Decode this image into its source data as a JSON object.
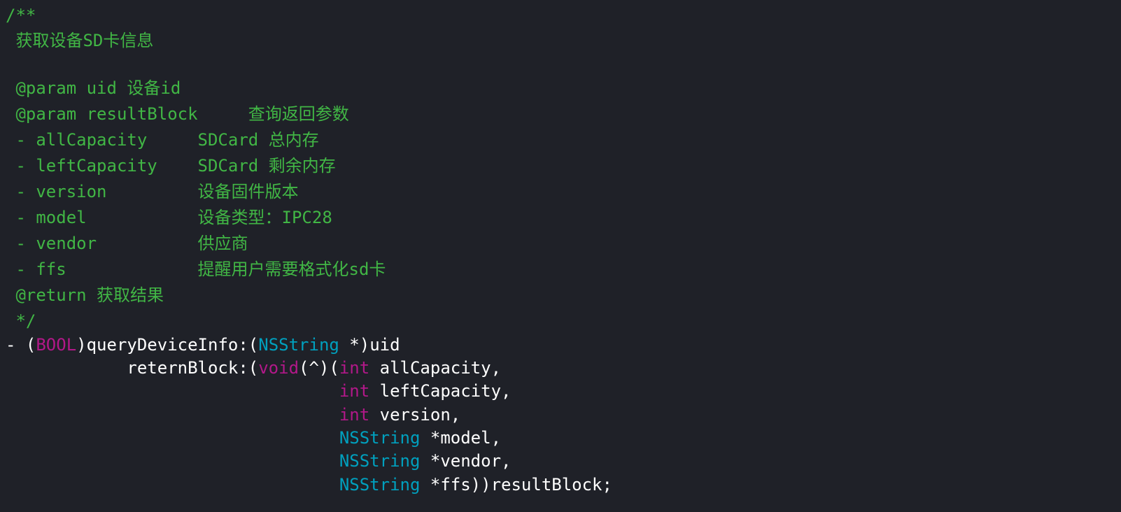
{
  "colors": {
    "background": "#1f2128",
    "comment": "#41b645",
    "keyword": "#b21889",
    "type": "#00a0be",
    "plain": "#ffffff"
  },
  "lines": [
    [
      {
        "text": "/**",
        "cls": "comment"
      }
    ],
    [
      {
        "text": " 获取设备SD卡信息",
        "cls": "comment"
      }
    ],
    [
      {
        "text": "",
        "cls": "comment"
      }
    ],
    [
      {
        "text": " @param uid 设备id",
        "cls": "comment"
      }
    ],
    [
      {
        "text": " @param resultBlock     查询返回参数",
        "cls": "comment"
      }
    ],
    [
      {
        "text": " - allCapacity     SDCard 总内存",
        "cls": "comment"
      }
    ],
    [
      {
        "text": " - leftCapacity    SDCard 剩余内存",
        "cls": "comment"
      }
    ],
    [
      {
        "text": " - version         设备固件版本",
        "cls": "comment"
      }
    ],
    [
      {
        "text": " - model           设备类型：IPC28",
        "cls": "comment"
      }
    ],
    [
      {
        "text": " - vendor          供应商",
        "cls": "comment"
      }
    ],
    [
      {
        "text": " - ffs             提醒用户需要格式化sd卡",
        "cls": "comment"
      }
    ],
    [
      {
        "text": " @return 获取结果",
        "cls": "comment"
      }
    ],
    [
      {
        "text": " */",
        "cls": "comment"
      }
    ],
    [
      {
        "text": "- (",
        "cls": "plain"
      },
      {
        "text": "BOOL",
        "cls": "keyword"
      },
      {
        "text": ")queryDeviceInfo:(",
        "cls": "plain"
      },
      {
        "text": "NSString",
        "cls": "type"
      },
      {
        "text": " *)uid",
        "cls": "plain"
      }
    ],
    [
      {
        "text": "            reternBlock:(",
        "cls": "plain"
      },
      {
        "text": "void",
        "cls": "keyword"
      },
      {
        "text": "(^)(",
        "cls": "plain"
      },
      {
        "text": "int",
        "cls": "keyword"
      },
      {
        "text": " allCapacity,",
        "cls": "plain"
      }
    ],
    [
      {
        "text": "                                 ",
        "cls": "plain"
      },
      {
        "text": "int",
        "cls": "keyword"
      },
      {
        "text": " leftCapacity,",
        "cls": "plain"
      }
    ],
    [
      {
        "text": "                                 ",
        "cls": "plain"
      },
      {
        "text": "int",
        "cls": "keyword"
      },
      {
        "text": " version,",
        "cls": "plain"
      }
    ],
    [
      {
        "text": "                                 ",
        "cls": "plain"
      },
      {
        "text": "NSString",
        "cls": "type"
      },
      {
        "text": " *model,",
        "cls": "plain"
      }
    ],
    [
      {
        "text": "                                 ",
        "cls": "plain"
      },
      {
        "text": "NSString",
        "cls": "type"
      },
      {
        "text": " *vendor,",
        "cls": "plain"
      }
    ],
    [
      {
        "text": "                                 ",
        "cls": "plain"
      },
      {
        "text": "NSString",
        "cls": "type"
      },
      {
        "text": " *ffs))resultBlock;",
        "cls": "plain"
      }
    ]
  ]
}
